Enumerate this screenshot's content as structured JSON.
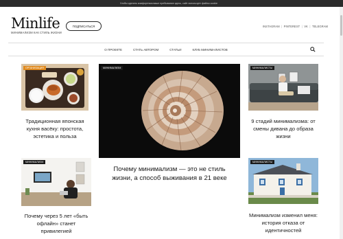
{
  "topbar": {
    "notice": "Чтобы сделать комфортным ваше пребывание здесь, сайт использует файлы cookie"
  },
  "header": {
    "logo": "Minlife",
    "tagline": "МИНИМАЛИЗМ КАК СТИЛЬ ЖИЗНИ",
    "subscribe_label": "ПОДПИСАТЬСЯ",
    "social": [
      "INSTAGRAM",
      "PINTEREST",
      "VK",
      "TELEGRAM"
    ]
  },
  "nav": {
    "items": [
      "О ПРОЕКТЕ",
      "СТАТЬ АВТОРОМ",
      "СТАТЬИ",
      "КЛУБ МИНИМАЛИСТОВ"
    ],
    "search_icon": "search-icon"
  },
  "articles": [
    {
      "badge": "ОРГАНИЗАЦИЯ",
      "title": "Традиционная японская кухня васёку: простота, эстетика и польза"
    },
    {
      "badge": "МИНИМАЛИЗМ",
      "title": "Почему минимализм — это не стиль жизни, а способ выживания в 21 веке"
    },
    {
      "badge": "МИНИМАЛИСТЫ",
      "title": "9 стадий минимализма: от смены дивана до образа жизни"
    },
    {
      "badge": "МИНИМАЛИЗМ",
      "title": "Почему через 5 лет «быть офлайн» станет привилегией"
    },
    {
      "badge": "МИНИМАЛИСТЫ",
      "title": "Минимализм изменил меня: история отказа от идентичностей"
    }
  ],
  "colors": {
    "topbar": "#2b2b2b",
    "badge": "#1a1a1a",
    "badge_orange": "#e08a1e"
  }
}
